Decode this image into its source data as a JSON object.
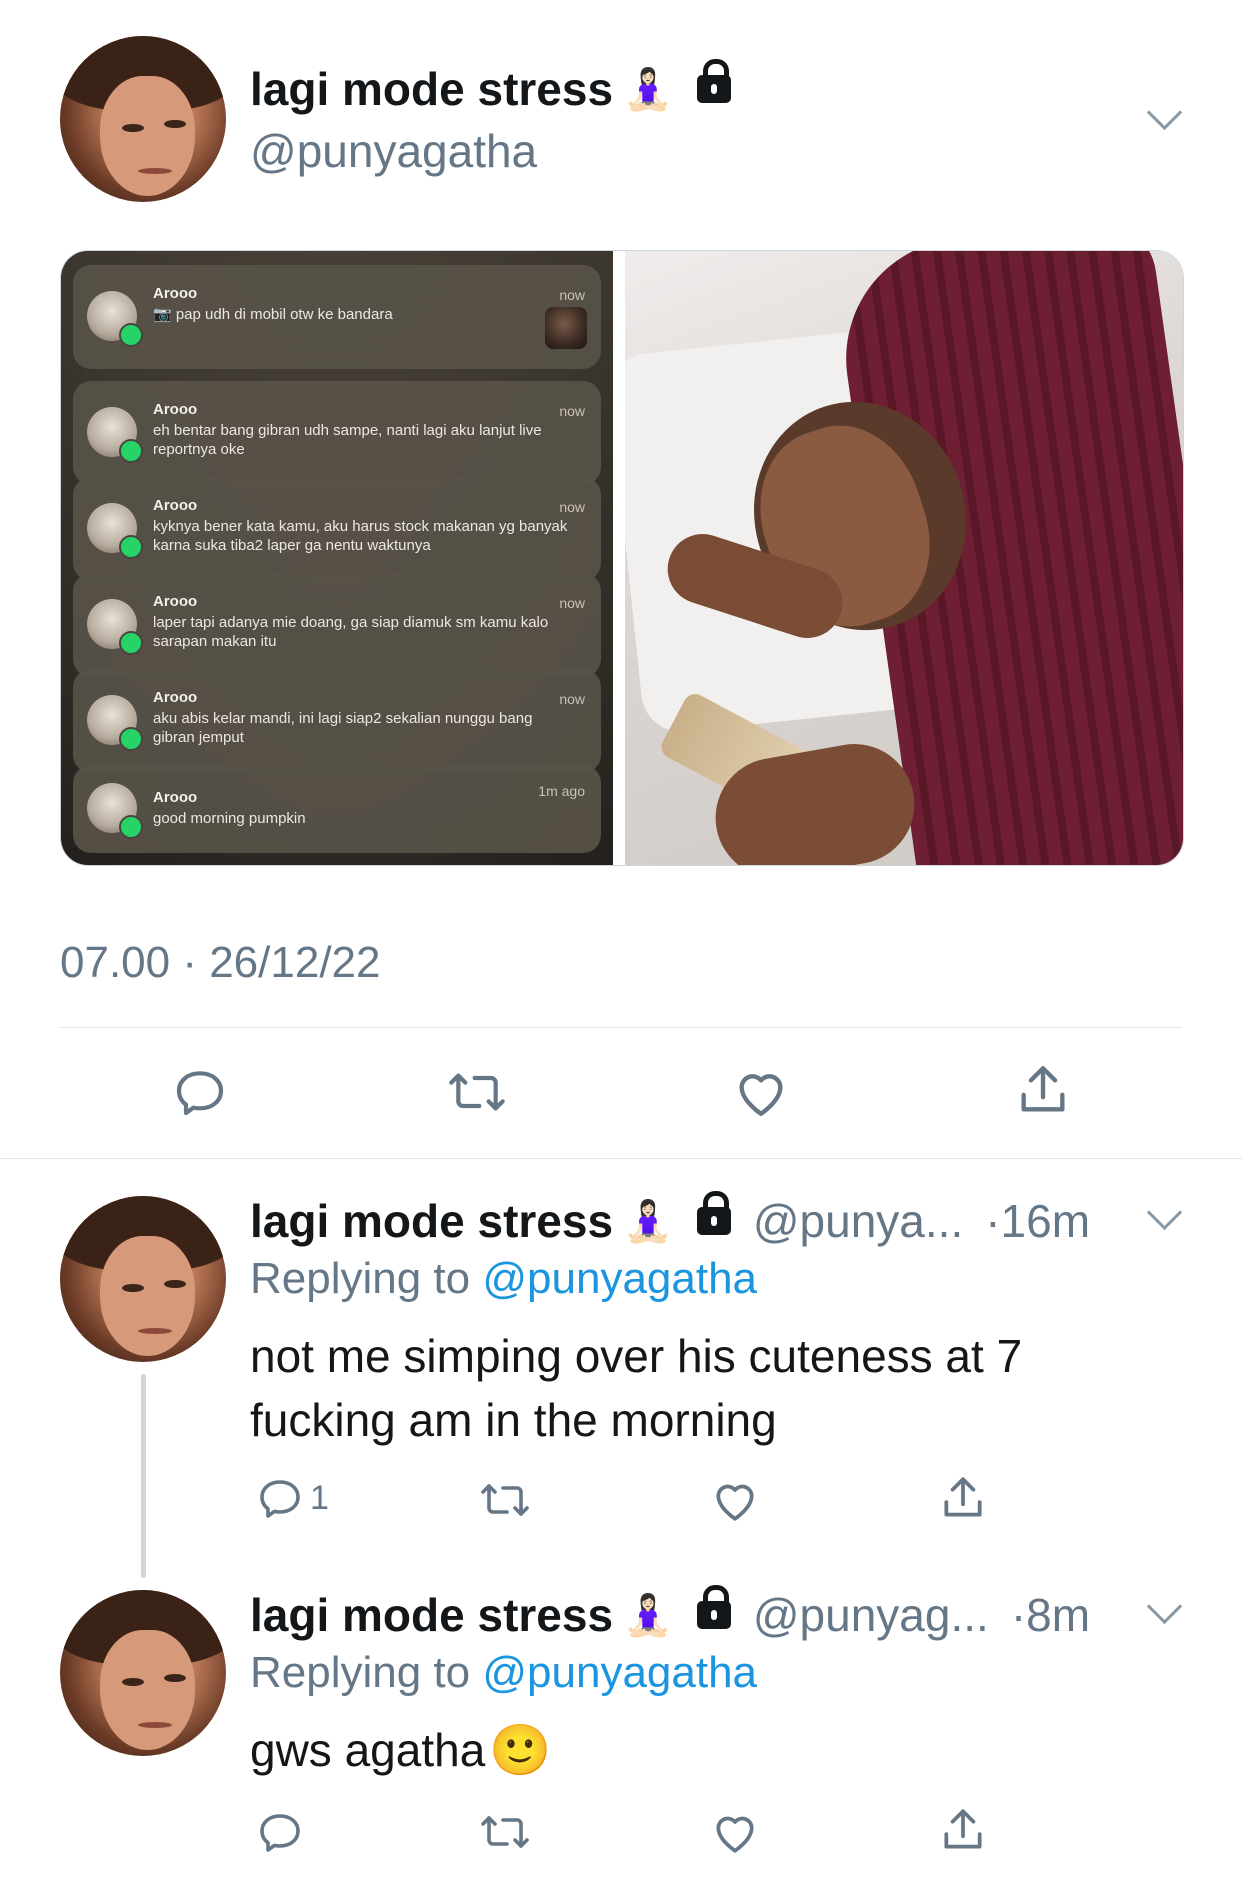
{
  "main_tweet": {
    "display_name": "lagi mode stress",
    "handle": "@punyagatha",
    "timestamp": "07.00 · 26/12/22",
    "notifications": [
      {
        "sender": "Arooo",
        "message": "📷 pap udh di mobil otw ke bandara",
        "time": "now",
        "has_thumb": true
      },
      {
        "sender": "Arooo",
        "message": "eh bentar bang gibran udh sampe, nanti lagi aku lanjut live reportnya oke",
        "time": "now"
      },
      {
        "sender": "Arooo",
        "message": "kyknya bener kata kamu, aku harus stock makanan yg banyak karna suka tiba2 laper ga nentu waktunya",
        "time": "now"
      },
      {
        "sender": "Arooo",
        "message": "laper tapi adanya mie doang, ga siap diamuk sm kamu kalo sarapan makan itu",
        "time": "now"
      },
      {
        "sender": "Arooo",
        "message": "aku abis kelar mandi, ini lagi siap2 sekalian nunggu bang gibran jemput",
        "time": "now"
      },
      {
        "sender": "Arooo",
        "message": "good morning pumpkin",
        "time": "1m ago"
      }
    ]
  },
  "replies": [
    {
      "display_name": "lagi mode stress",
      "handle": "@punya...",
      "age": "·16m",
      "replying_label": "Replying to",
      "replying_to": "@punyagatha",
      "text": "not me simping over his cuteness at 7 fucking am in the morning",
      "reply_count": "1"
    },
    {
      "display_name": "lagi mode stress",
      "handle": "@punyag...",
      "age": "·8m",
      "replying_label": "Replying to",
      "replying_to": "@punyagatha",
      "text": "gws agatha",
      "emoji": "🙂"
    }
  ],
  "icons": {
    "reply": "reply-icon",
    "retweet": "retweet-icon",
    "like": "heart-icon",
    "share": "share-icon",
    "lock": "lock-icon",
    "meditation": "person-in-lotus-position-icon",
    "more": "chevron-down-icon"
  },
  "colors": {
    "link": "#1b95e0",
    "secondary_text": "#657786",
    "divider": "#e1e8ed"
  }
}
